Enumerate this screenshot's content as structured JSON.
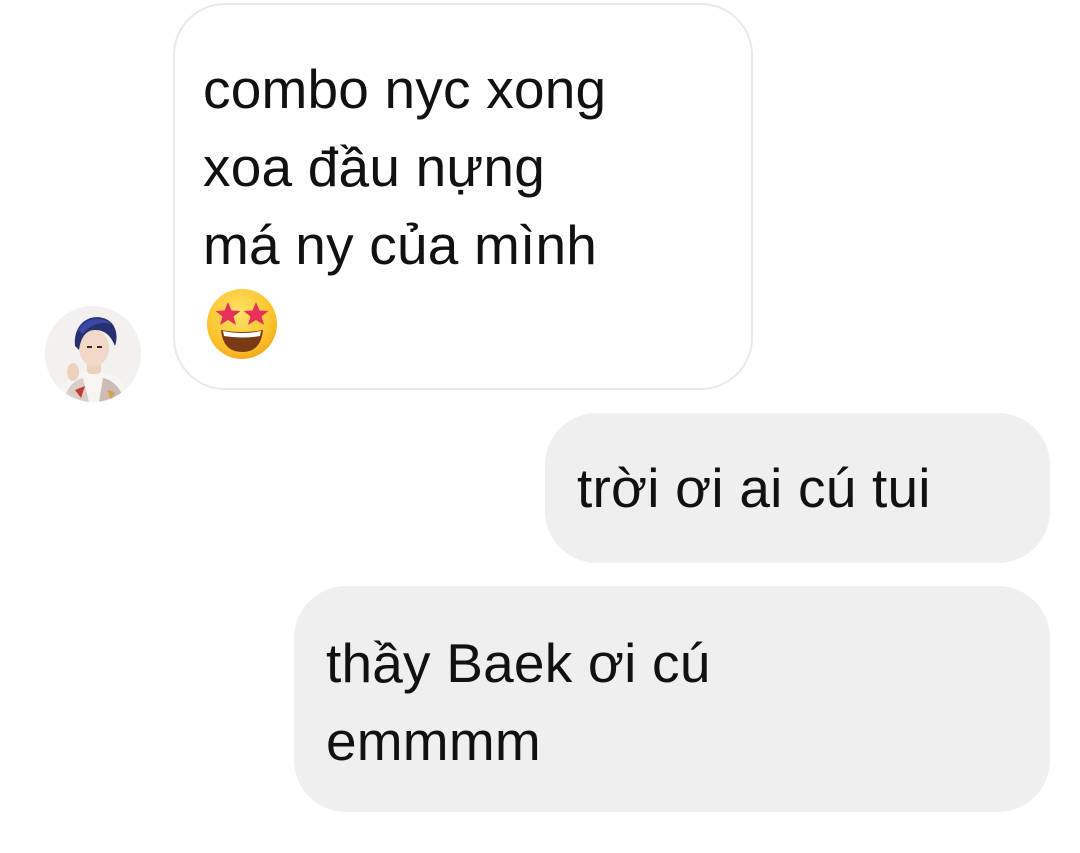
{
  "thread": {
    "contact": {
      "avatar_icon": "profile-photo"
    },
    "messages": [
      {
        "direction": "incoming",
        "lines": [
          "combo nyc xong",
          "xoa đầu nựng",
          "má ny của mình"
        ],
        "emoji": "star-struck-emoji"
      },
      {
        "direction": "outgoing",
        "lines": [
          "trời ơi ai cú tui"
        ]
      },
      {
        "direction": "outgoing",
        "lines": [
          "thầy Baek ơi cú",
          "emmmm"
        ]
      }
    ]
  },
  "colors": {
    "incoming_bubble": "#ffffff",
    "incoming_border": "#e9e9e9",
    "outgoing_bubble": "#efefef",
    "text": "#111111"
  }
}
